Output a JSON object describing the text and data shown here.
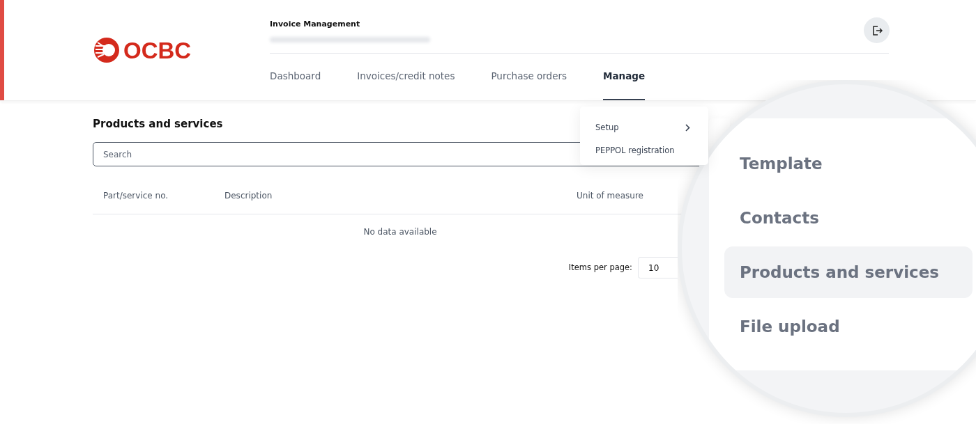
{
  "brand": {
    "name": "OCBC"
  },
  "header": {
    "title": "Invoice Management"
  },
  "nav": [
    {
      "label": "Dashboard",
      "selected": false
    },
    {
      "label": "Invoices/credit notes",
      "selected": false
    },
    {
      "label": "Purchase orders",
      "selected": false
    },
    {
      "label": "Manage",
      "selected": true
    }
  ],
  "menu": {
    "items": [
      {
        "label": "Setup",
        "kind": "submenu"
      },
      {
        "label": "PEPPOL registration",
        "kind": "link"
      }
    ]
  },
  "page": {
    "title": "Products and services",
    "search": {
      "placeholder": "Search"
    },
    "table": {
      "columns": [
        "Part/service no.",
        "Description",
        "Unit of measure"
      ],
      "empty_text": "No data available"
    },
    "pagination": {
      "label": "Items per page:",
      "value": "10"
    }
  },
  "magnifier": {
    "items": [
      {
        "label": "Template",
        "selected": false
      },
      {
        "label": "Contacts",
        "selected": false
      },
      {
        "label": "Products and services",
        "selected": true
      },
      {
        "label": "File upload",
        "selected": false
      }
    ]
  }
}
